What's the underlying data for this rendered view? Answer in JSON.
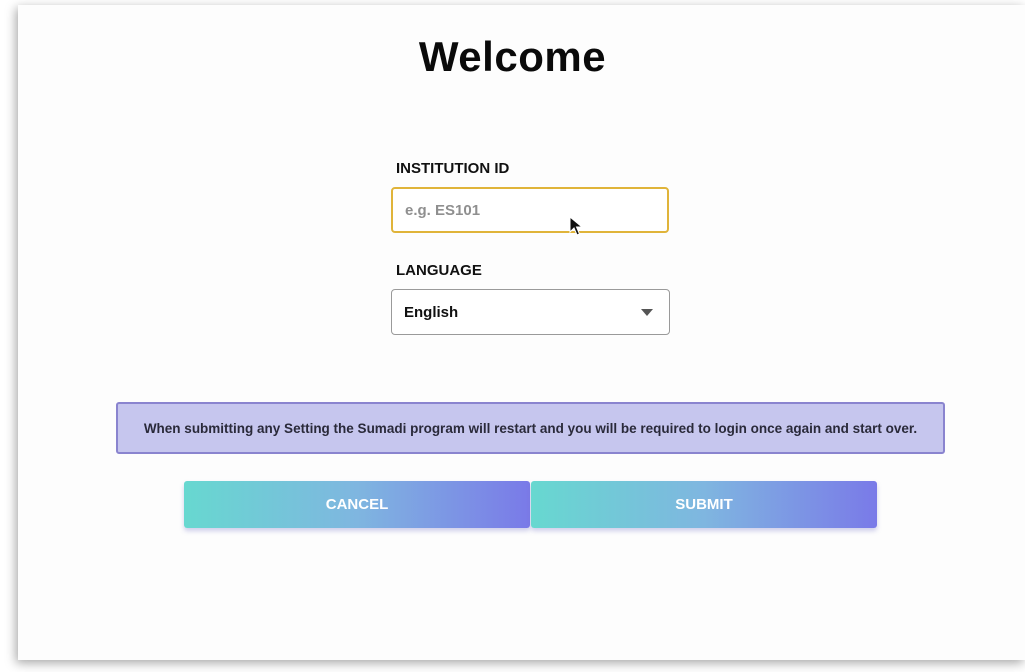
{
  "page": {
    "title": "Welcome"
  },
  "form": {
    "institution_label": "INSTITUTION ID",
    "institution_placeholder": "e.g. ES101",
    "institution_value": "",
    "language_label": "LANGUAGE",
    "language_selected": "English"
  },
  "notice": {
    "text": "When submitting any Setting the Sumadi program will restart and you will be required to login once again and start over."
  },
  "buttons": {
    "cancel_label": "CANCEL",
    "submit_label": "SUBMIT"
  },
  "colors": {
    "focus_border": "#e0b43a",
    "notice_bg": "#c6c6ee",
    "notice_border": "#8a84cf",
    "button_gradient_start": "#67d8d0",
    "button_gradient_end": "#7a7ae8"
  },
  "icons": {
    "dropdown": "chevron-down-icon",
    "pointer": "mouse-cursor-icon"
  }
}
